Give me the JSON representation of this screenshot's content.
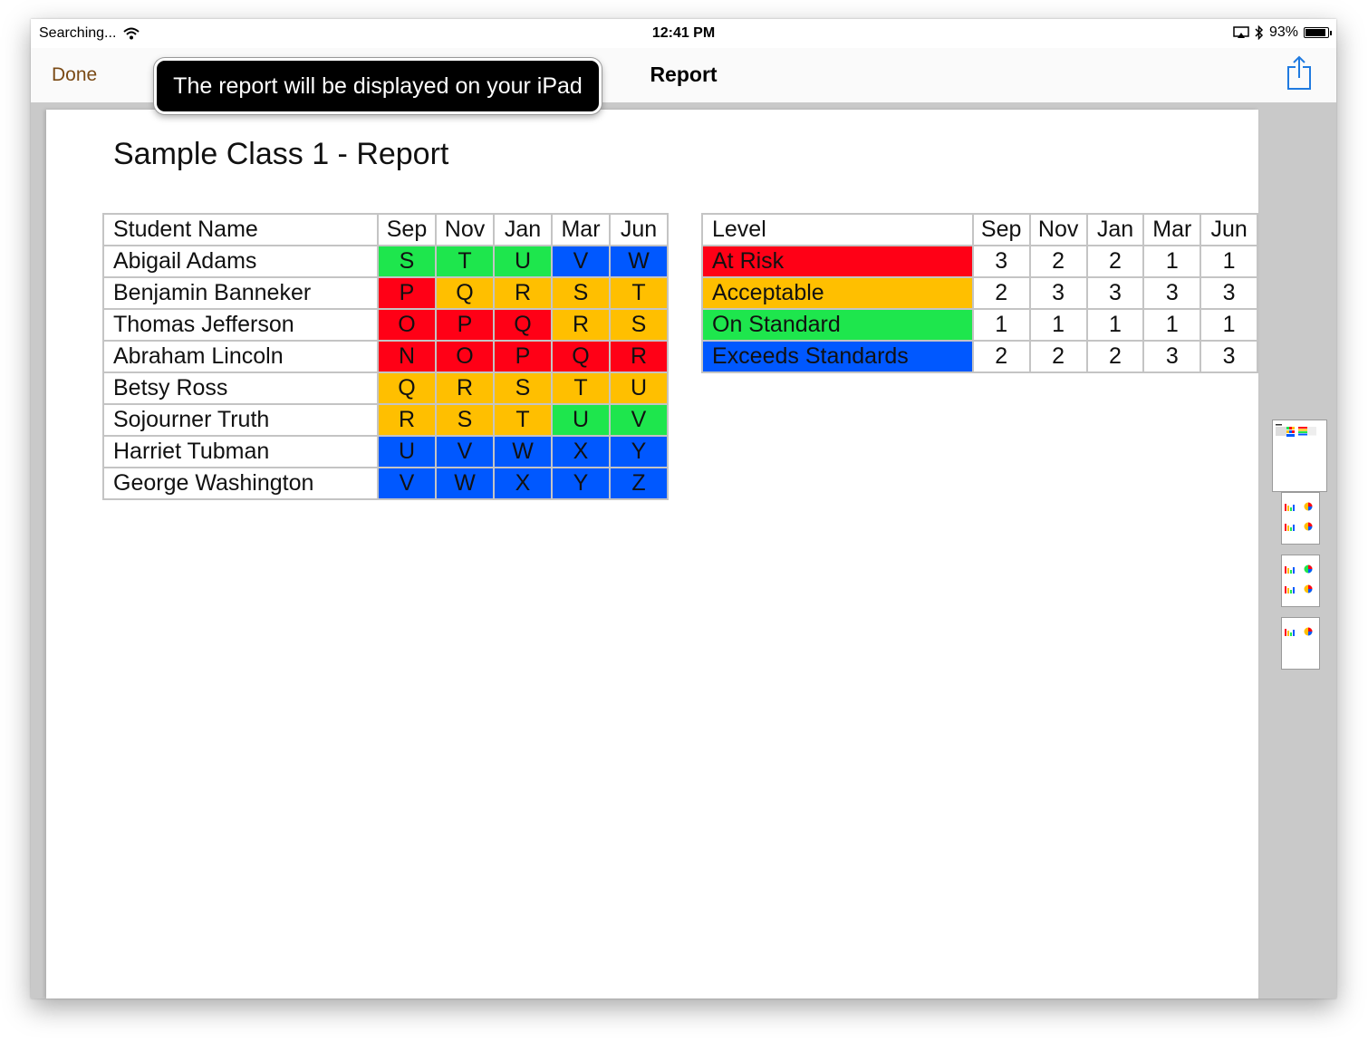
{
  "status_bar": {
    "carrier": "Searching...",
    "time": "12:41 PM",
    "battery": "93%",
    "battery_level": 0.93,
    "icons": [
      "wifi-icon",
      "airplay-icon",
      "bluetooth-icon",
      "battery-icon"
    ]
  },
  "nav": {
    "done_label": "Done",
    "title": "Report",
    "share_icon": "share-icon",
    "accent_color": "#7a4a15"
  },
  "tooltip": {
    "text": "The report will be displayed on your iPad"
  },
  "report": {
    "title": "Sample Class 1 - Report",
    "level_colors": {
      "red": "#ff0016",
      "yellow": "#ffbf00",
      "green": "#1ee64d",
      "blue": "#0058ff"
    },
    "students_table": {
      "header": {
        "name": "Student Name",
        "months": [
          "Sep",
          "Nov",
          "Jan",
          "Mar",
          "Jun"
        ]
      },
      "rows": [
        {
          "name": "Abigail Adams",
          "cells": [
            {
              "v": "S",
              "c": "green"
            },
            {
              "v": "T",
              "c": "green"
            },
            {
              "v": "U",
              "c": "green"
            },
            {
              "v": "V",
              "c": "blue"
            },
            {
              "v": "W",
              "c": "blue"
            }
          ]
        },
        {
          "name": "Benjamin Banneker",
          "cells": [
            {
              "v": "P",
              "c": "red"
            },
            {
              "v": "Q",
              "c": "yellow"
            },
            {
              "v": "R",
              "c": "yellow"
            },
            {
              "v": "S",
              "c": "yellow"
            },
            {
              "v": "T",
              "c": "yellow"
            }
          ]
        },
        {
          "name": "Thomas Jefferson",
          "cells": [
            {
              "v": "O",
              "c": "red"
            },
            {
              "v": "P",
              "c": "red"
            },
            {
              "v": "Q",
              "c": "red"
            },
            {
              "v": "R",
              "c": "yellow"
            },
            {
              "v": "S",
              "c": "yellow"
            }
          ]
        },
        {
          "name": "Abraham Lincoln",
          "cells": [
            {
              "v": "N",
              "c": "red"
            },
            {
              "v": "O",
              "c": "red"
            },
            {
              "v": "P",
              "c": "red"
            },
            {
              "v": "Q",
              "c": "red"
            },
            {
              "v": "R",
              "c": "red"
            }
          ]
        },
        {
          "name": "Betsy Ross",
          "cells": [
            {
              "v": "Q",
              "c": "yellow"
            },
            {
              "v": "R",
              "c": "yellow"
            },
            {
              "v": "S",
              "c": "yellow"
            },
            {
              "v": "T",
              "c": "yellow"
            },
            {
              "v": "U",
              "c": "yellow"
            }
          ]
        },
        {
          "name": "Sojourner Truth",
          "cells": [
            {
              "v": "R",
              "c": "yellow"
            },
            {
              "v": "S",
              "c": "yellow"
            },
            {
              "v": "T",
              "c": "yellow"
            },
            {
              "v": "U",
              "c": "green"
            },
            {
              "v": "V",
              "c": "green"
            }
          ]
        },
        {
          "name": "Harriet Tubman",
          "cells": [
            {
              "v": "U",
              "c": "blue"
            },
            {
              "v": "V",
              "c": "blue"
            },
            {
              "v": "W",
              "c": "blue"
            },
            {
              "v": "X",
              "c": "blue"
            },
            {
              "v": "Y",
              "c": "blue"
            }
          ]
        },
        {
          "name": "George Washington",
          "cells": [
            {
              "v": "V",
              "c": "blue"
            },
            {
              "v": "W",
              "c": "blue"
            },
            {
              "v": "X",
              "c": "blue"
            },
            {
              "v": "Y",
              "c": "blue"
            },
            {
              "v": "Z",
              "c": "blue"
            }
          ]
        }
      ]
    },
    "levels_table": {
      "header": {
        "name": "Level",
        "months": [
          "Sep",
          "Nov",
          "Jan",
          "Mar",
          "Jun"
        ]
      },
      "rows": [
        {
          "name": "At Risk",
          "color": "red",
          "counts": [
            "3",
            "2",
            "2",
            "1",
            "1"
          ]
        },
        {
          "name": "Acceptable",
          "color": "yellow",
          "counts": [
            "2",
            "3",
            "3",
            "3",
            "3"
          ]
        },
        {
          "name": "On Standard",
          "color": "green",
          "counts": [
            "1",
            "1",
            "1",
            "1",
            "1"
          ]
        },
        {
          "name": "Exceeds Standards",
          "color": "blue",
          "counts": [
            "2",
            "2",
            "2",
            "3",
            "3"
          ]
        }
      ]
    }
  },
  "thumbnails": {
    "count": 4,
    "selected_index": 0
  }
}
